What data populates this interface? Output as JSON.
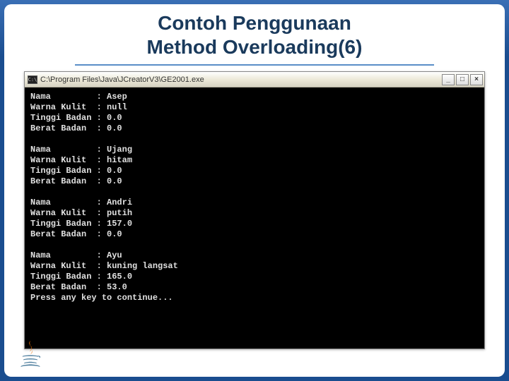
{
  "slide": {
    "title_line1": "Contoh Penggunaan",
    "title_line2": "Method Overloading(6)"
  },
  "window": {
    "cmd_icon_text": "C:\\",
    "title": "C:\\Program Files\\Java\\JCreatorV3\\GE2001.exe",
    "minimize_glyph": "_",
    "maximize_glyph": "□",
    "close_glyph": "×"
  },
  "console": {
    "labels": {
      "nama": "Nama",
      "warna_kulit": "Warna Kulit",
      "tinggi_badan": "Tinggi Badan",
      "berat_badan": "Berat Badan"
    },
    "records": [
      {
        "nama": "Asep",
        "warna_kulit": "null",
        "tinggi": "0.0",
        "berat": "0.0"
      },
      {
        "nama": "Ujang",
        "warna_kulit": "hitam",
        "tinggi": "0.0",
        "berat": "0.0"
      },
      {
        "nama": "Andri",
        "warna_kulit": "putih",
        "tinggi": "157.0",
        "berat": "0.0"
      },
      {
        "nama": "Ayu",
        "warna_kulit": "kuning langsat",
        "tinggi": "165.0",
        "berat": "53.0"
      }
    ],
    "footer": "Press any key to continue..."
  }
}
